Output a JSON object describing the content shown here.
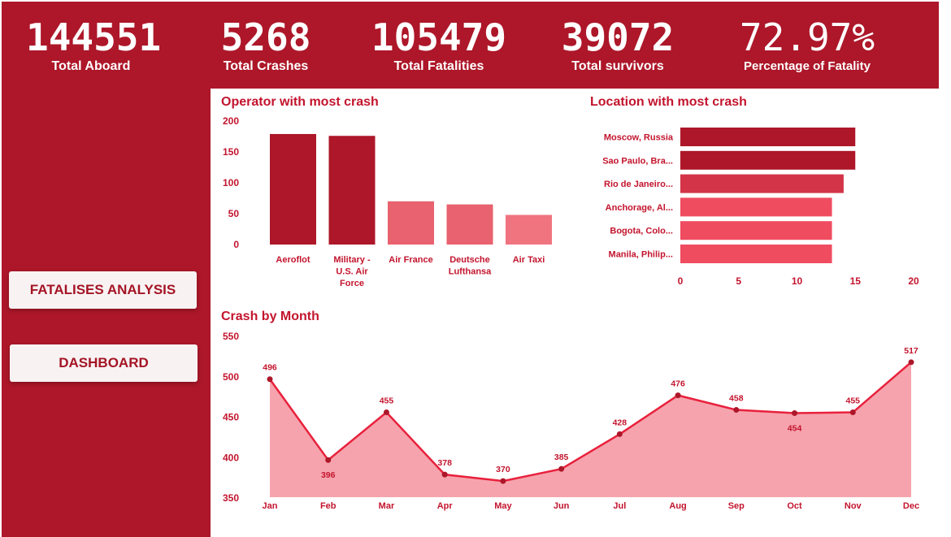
{
  "kpis": {
    "total_aboard": {
      "value": "144551",
      "label": "Total Aboard"
    },
    "total_crashes": {
      "value": "5268",
      "label": "Total Crashes"
    },
    "total_fatalities": {
      "value": "105479",
      "label": "Total Fatalities"
    },
    "total_survivors": {
      "value": "39072",
      "label": "Total survivors"
    },
    "fatality_pct": {
      "value": "72.97%",
      "label": "Percentage of Fatality"
    }
  },
  "nav": {
    "fatalities_analysis": "FATALISES ANALYSIS",
    "dashboard": "DASHBOARD"
  },
  "colors": {
    "brand": "#ad1729",
    "dark_bar": "#ad1729",
    "mid_bar": "#e8626f",
    "light_bar": "#f07480",
    "area_fill": "#f6a3ad",
    "line": "#e8213c",
    "text": "#c3142d"
  },
  "charts": {
    "operator": {
      "title": "Operator with most crash"
    },
    "location": {
      "title": "Location with most crash"
    },
    "month": {
      "title": "Crash by Month"
    }
  },
  "chart_data": [
    {
      "type": "bar",
      "title": "Operator with most crash",
      "categories": [
        "Aeroflot",
        "Military - U.S. Air Force",
        "Air France",
        "Deutsche Lufthansa",
        "Air Taxi"
      ],
      "category_lines": [
        [
          "Aeroflot"
        ],
        [
          "Military -",
          "U.S. Air",
          "Force"
        ],
        [
          "Air France"
        ],
        [
          "Deutsche",
          "Lufthansa"
        ],
        [
          "Air Taxi"
        ]
      ],
      "values": [
        179,
        176,
        70,
        65,
        48
      ],
      "bar_colors": [
        "#ad1729",
        "#ad1729",
        "#e8626f",
        "#e8626f",
        "#f07480"
      ],
      "ylim": [
        0,
        200
      ],
      "yticks": [
        0,
        50,
        100,
        150,
        200
      ],
      "grid": false
    },
    {
      "type": "bar",
      "orientation": "horizontal",
      "title": "Location with most crash",
      "categories": [
        "Moscow, Russia",
        "Sao Paulo, Bra...",
        "Rio de Janeiro...",
        "Anchorage, Al...",
        "Bogota, Colo...",
        "Manila, Philip..."
      ],
      "values": [
        15,
        15,
        14,
        13,
        13,
        13
      ],
      "bar_colors": [
        "#ad1729",
        "#ad1729",
        "#d33447",
        "#ef4c60",
        "#ef4c60",
        "#ef4c60"
      ],
      "xlim": [
        0,
        20
      ],
      "xticks": [
        0,
        5,
        10,
        15,
        20
      ],
      "grid": false
    },
    {
      "type": "area",
      "title": "Crash by Month",
      "x": [
        "Jan",
        "Feb",
        "Mar",
        "Apr",
        "May",
        "Jun",
        "Jul",
        "Aug",
        "Sep",
        "Oct",
        "Nov",
        "Dec"
      ],
      "values": [
        496,
        396,
        455,
        378,
        370,
        385,
        428,
        476,
        458,
        454,
        455,
        517
      ],
      "label_position": [
        "above",
        "below",
        "above",
        "above",
        "above",
        "above",
        "above",
        "above",
        "above",
        "below",
        "above",
        "above"
      ],
      "ylim": [
        350,
        550
      ],
      "yticks": [
        350,
        400,
        450,
        500,
        550
      ],
      "grid": false
    }
  ]
}
